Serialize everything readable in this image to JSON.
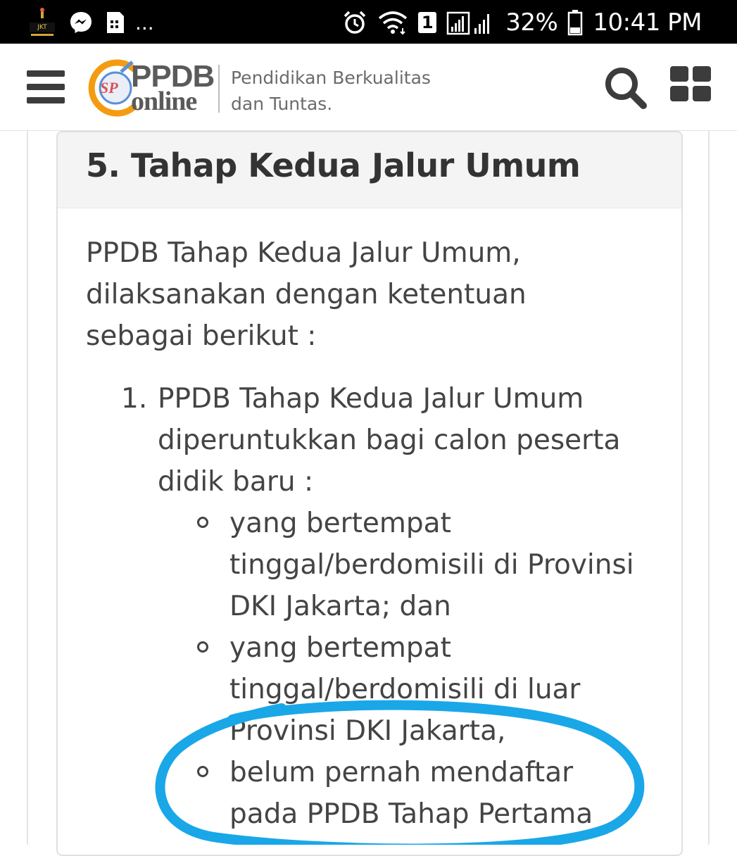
{
  "status_bar": {
    "dots": "...",
    "battery_percent": "32%",
    "time": "10:41 PM",
    "sim_badge": "1",
    "icons": [
      "app-logo-icon",
      "messenger-icon",
      "sim-card-icon",
      "alarm-icon",
      "wifi-icon",
      "signal-icon",
      "battery-icon"
    ]
  },
  "header": {
    "logo_ppdb": "PPDB",
    "logo_online": "online",
    "logo_badge": "SP",
    "tagline_line1": "Pendidikan Berkualitas",
    "tagline_line2": "dan Tuntas.",
    "icons": [
      "hamburger-menu-icon",
      "search-icon",
      "grid-menu-icon"
    ]
  },
  "section": {
    "title": "5. Tahap Kedua Jalur Umum",
    "intro": "PPDB Tahap Kedua Jalur Umum, dilaksanakan dengan ketentuan sebagai berikut :",
    "items": [
      {
        "number": "1.",
        "text": "PPDB Tahap Kedua Jalur Umum diperuntukkan bagi calon peserta didik baru :",
        "subitems": [
          "yang bertempat tinggal/berdomisili di Provinsi DKI Jakarta; dan",
          "yang bertempat tinggal/berdomisili di luar Provinsi DKI Jakarta,",
          "belum pernah mendaftar pada PPDB Tahap Pertama"
        ]
      }
    ]
  },
  "colors": {
    "status_bar_bg": "#000000",
    "title_text": "#333333",
    "body_text": "#444444",
    "card_header_bg": "#f4f4f4",
    "annotation_stroke": "#1aa7e8",
    "logo_orange": "#f39c12",
    "logo_blue": "#5b8fd6"
  }
}
